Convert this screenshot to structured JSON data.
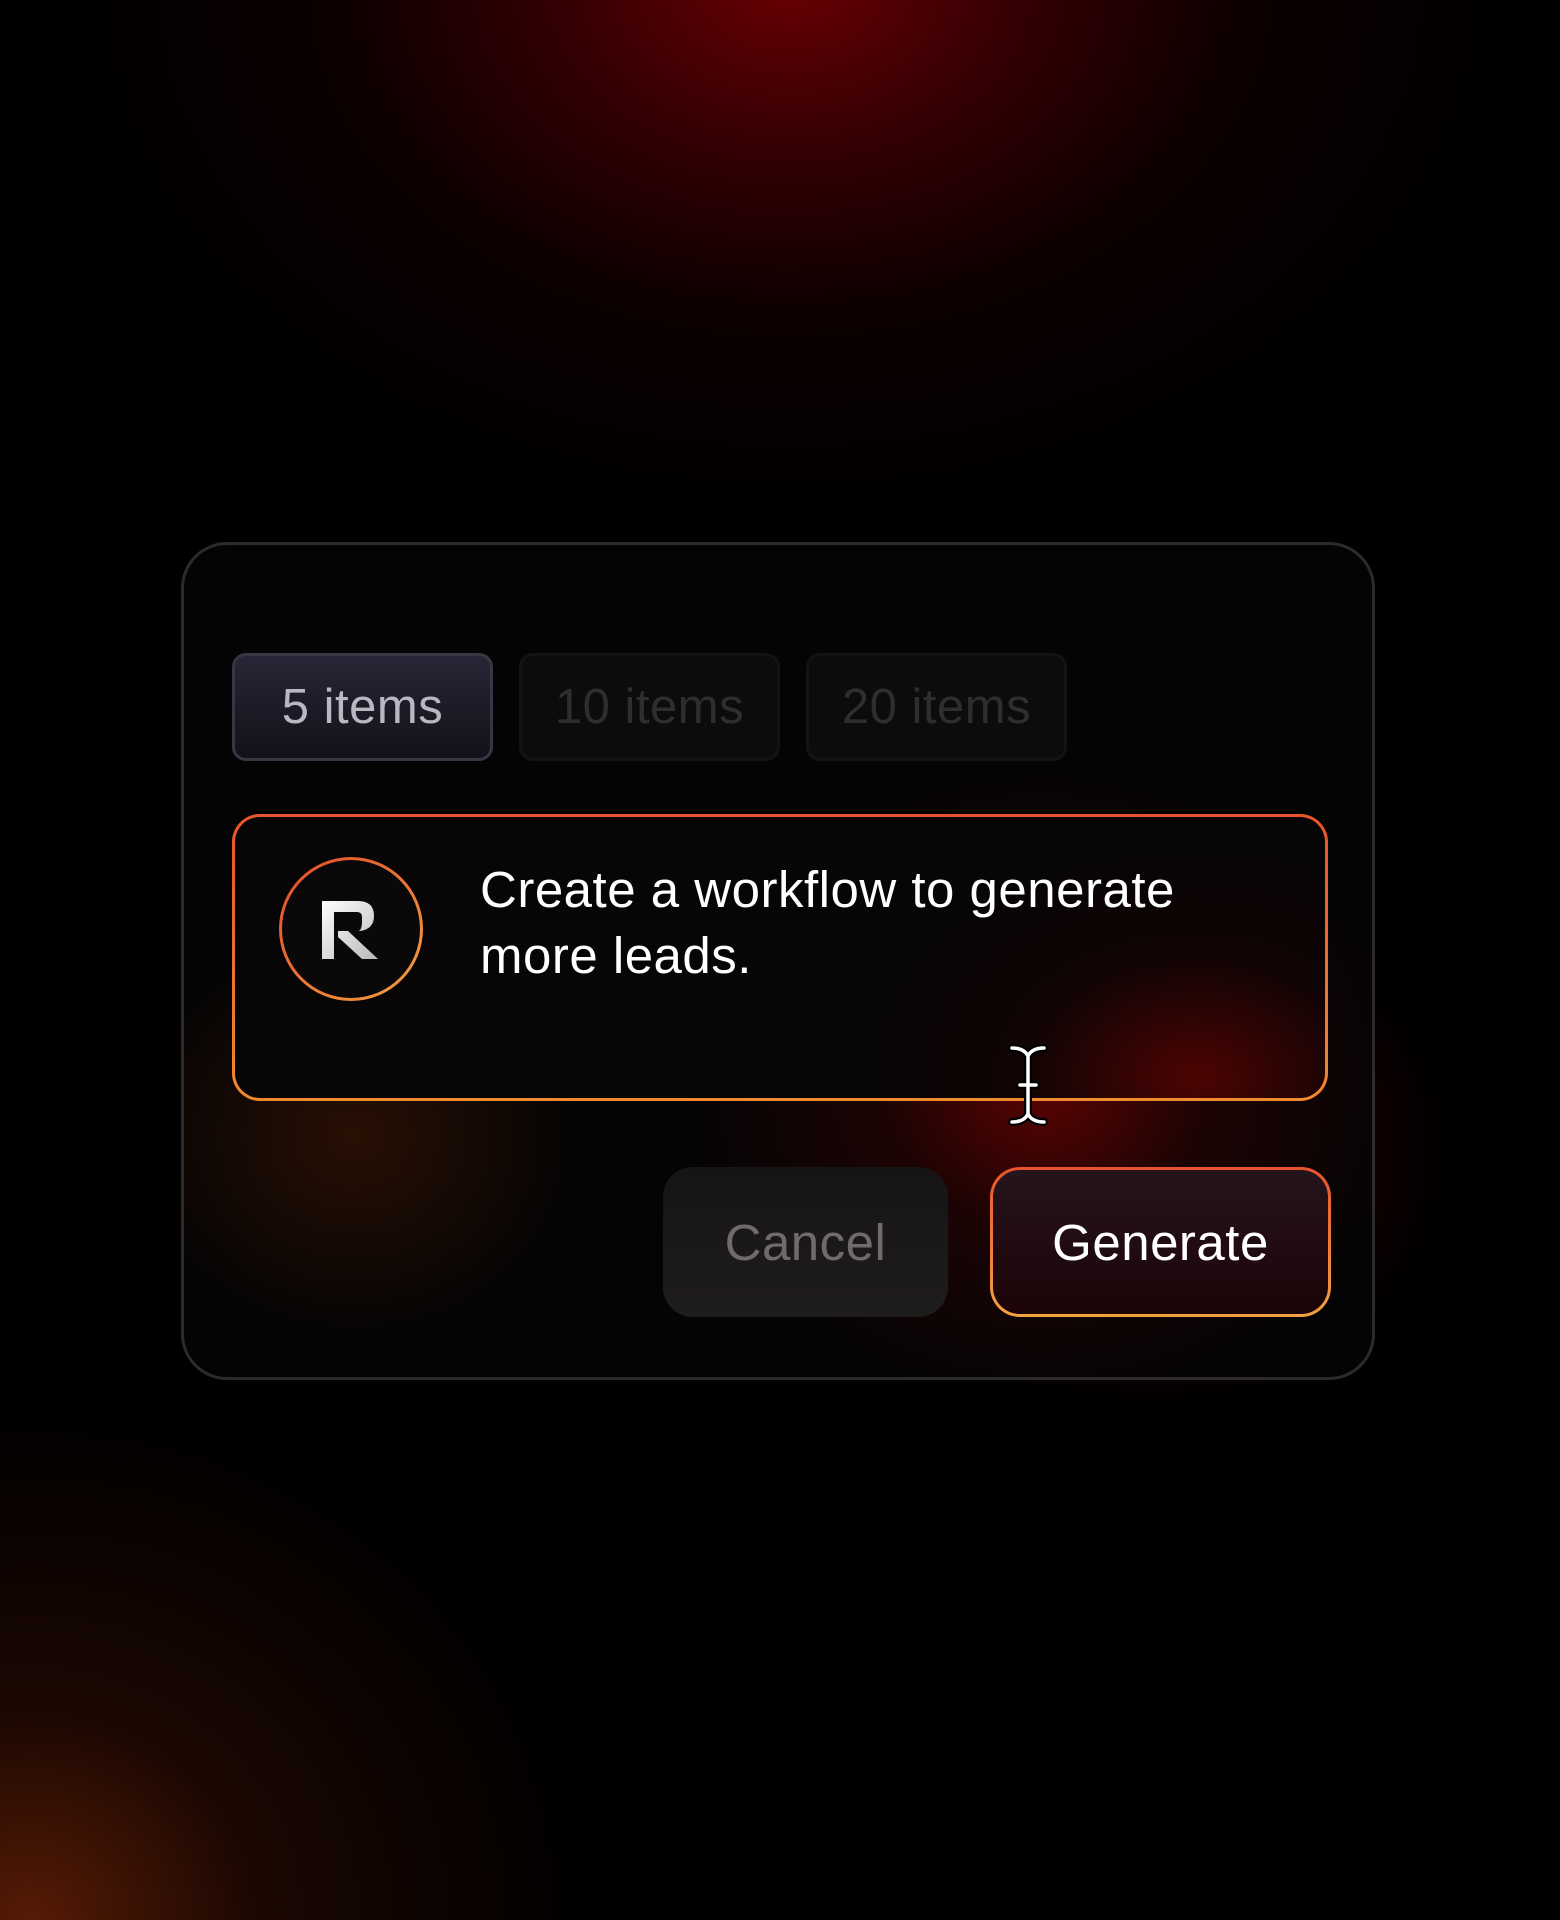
{
  "chips": [
    {
      "label": "5 items",
      "state": "selected"
    },
    {
      "label": "10 items",
      "state": "unselected"
    },
    {
      "label": "20 items",
      "state": "unselected"
    }
  ],
  "prompt": {
    "avatar_icon": "r-logo-icon",
    "text": "Create a workflow to generate more leads."
  },
  "actions": {
    "cancel_label": "Cancel",
    "generate_label": "Generate"
  },
  "cursor_icon": "text-cursor-icon",
  "colors": {
    "accent_start": "#e8532d",
    "accent_end": "#f4a040",
    "background": "#000000",
    "glow_red": "#6e0005"
  }
}
